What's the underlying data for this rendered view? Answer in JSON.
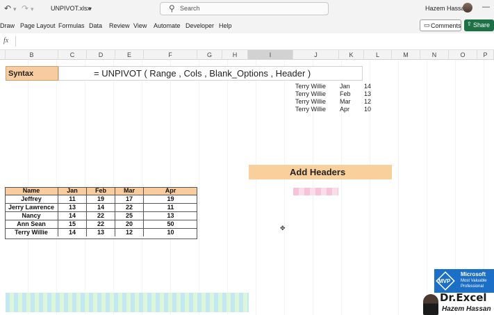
{
  "titlebar": {
    "undo_icon": "undo-icon",
    "redo_icon": "redo-icon",
    "file_name": "UNPIVOT.xlsx",
    "search_placeholder": "Search",
    "user_name": "Hazem Hassan",
    "minimize": "—"
  },
  "ribbon": {
    "items": [
      "Draw",
      "Page Layout",
      "Formulas",
      "Data",
      "Review",
      "View",
      "Automate",
      "Developer",
      "Help"
    ],
    "comments_label": "Comments",
    "share_label": "Share"
  },
  "formula_bar": {
    "fx": "fx"
  },
  "columns": [
    "B",
    "C",
    "D",
    "E",
    "F",
    "G",
    "H",
    "I",
    "J",
    "K",
    "L",
    "M",
    "N",
    "O",
    "P"
  ],
  "selected_column": "I",
  "syntax": {
    "label": "Syntax",
    "formula": "= UNPIVOT ( Range , Cols , Blank_Options , Header )"
  },
  "unpivot_output": [
    {
      "name": "Terry Willie",
      "month": "Jan",
      "value": "14"
    },
    {
      "name": "Terry Willie",
      "month": "Feb",
      "value": "13"
    },
    {
      "name": "Terry Willie",
      "month": "Mar",
      "value": "12"
    },
    {
      "name": "Terry Willie",
      "month": "Apr",
      "value": "10"
    }
  ],
  "add_headers_label": "Add Headers",
  "table": {
    "headers": [
      "Name",
      "Jan",
      "Feb",
      "Mar",
      "Apr"
    ],
    "rows": [
      [
        "Jeffrey",
        "11",
        "19",
        "17",
        "19"
      ],
      [
        "Jerry Lawrence",
        "13",
        "14",
        "22",
        "11"
      ],
      [
        "Nancy",
        "14",
        "22",
        "25",
        "13"
      ],
      [
        "Ann Sean",
        "15",
        "22",
        "20",
        "50"
      ],
      [
        "Terry Willie",
        "14",
        "13",
        "12",
        "10"
      ]
    ]
  },
  "branding": {
    "mvp_short": "MVP",
    "mvp_company": "Microsoft",
    "mvp_line2": "Most Valuable",
    "mvp_line3": "Professional",
    "name": "Dr.Excel",
    "subtitle": "Hazem Hassan"
  },
  "colors": {
    "syntax_fill": "#f8cba0",
    "header_fill": "#f8cc9c",
    "add_headers_fill": "#f9cf9c",
    "share_green": "#1e7145",
    "mvp_blue": "#1c6fc7"
  }
}
